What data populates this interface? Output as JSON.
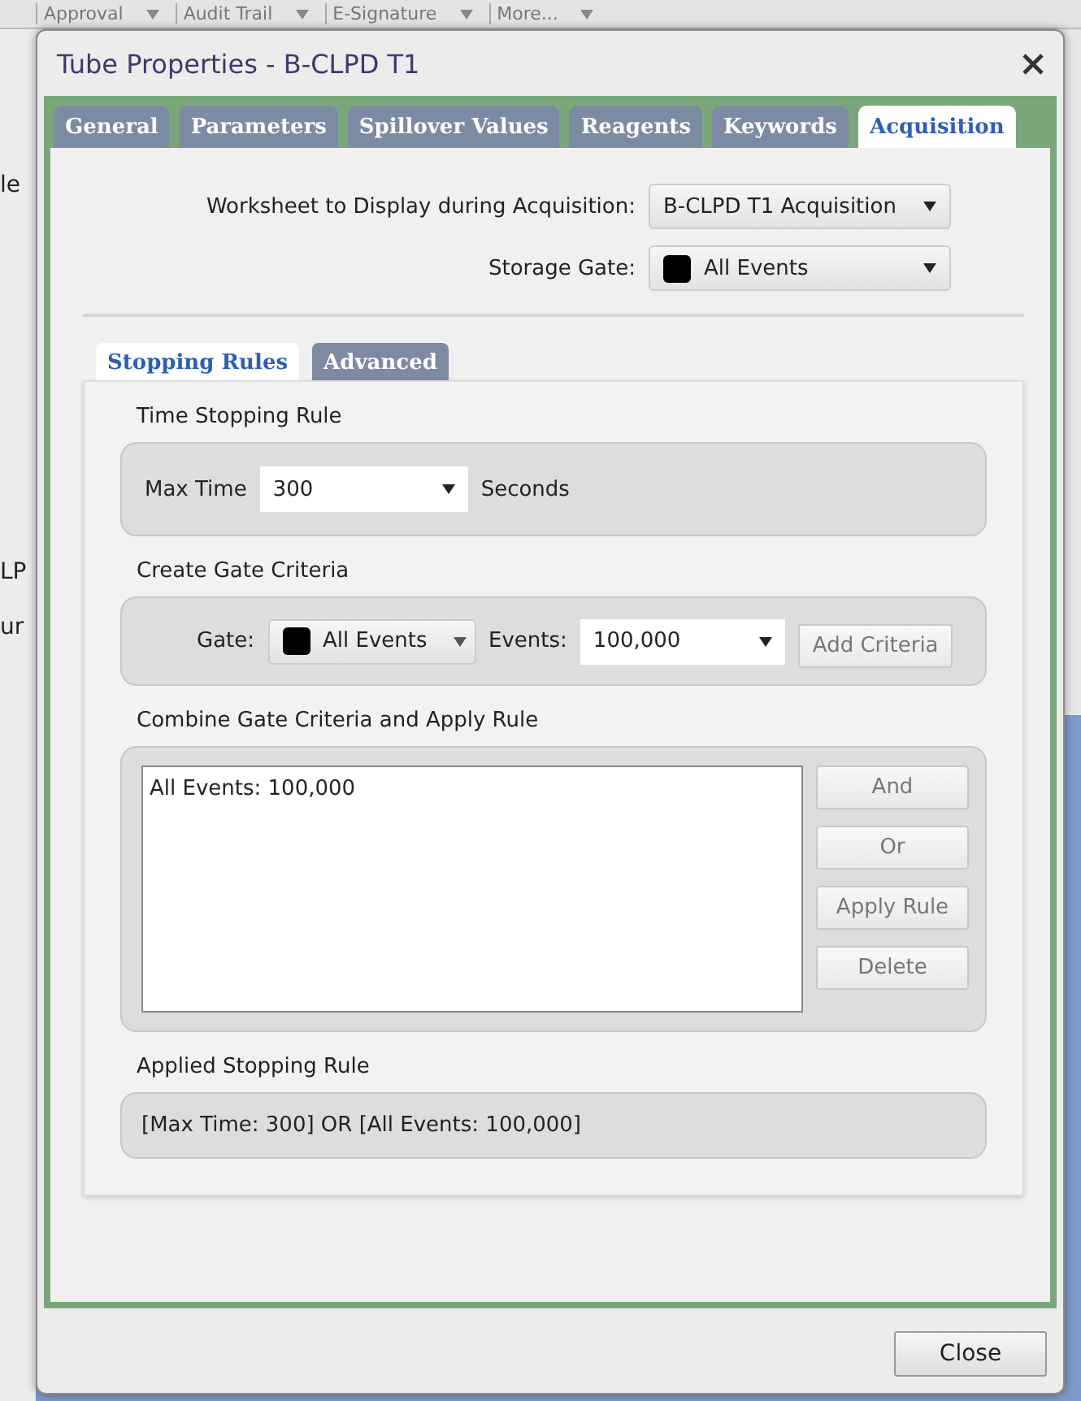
{
  "background": {
    "toolbar": [
      {
        "label": "Approval"
      },
      {
        "label": "Audit Trail"
      },
      {
        "label": "E-Signature"
      },
      {
        "label": "More..."
      }
    ],
    "side_fragments": [
      "le",
      "LP",
      "ur"
    ]
  },
  "dialog": {
    "title": "Tube Properties - B-CLPD T1",
    "tabs": [
      {
        "label": "General",
        "selected": false
      },
      {
        "label": "Parameters",
        "selected": false
      },
      {
        "label": "Spillover Values",
        "selected": false
      },
      {
        "label": "Reagents",
        "selected": false
      },
      {
        "label": "Keywords",
        "selected": false
      },
      {
        "label": "Acquisition",
        "selected": true
      }
    ],
    "worksheet": {
      "label": "Worksheet to Display during Acquisition:",
      "value": "B-CLPD T1 Acquisition"
    },
    "storage_gate": {
      "label": "Storage Gate:",
      "value": "All Events"
    },
    "subtabs": [
      {
        "label": "Stopping Rules",
        "selected": true
      },
      {
        "label": "Advanced",
        "selected": false
      }
    ],
    "time_rule": {
      "title": "Time Stopping Rule",
      "label": "Max Time",
      "value": "300",
      "unit": "Seconds"
    },
    "gate_criteria": {
      "title": "Create Gate Criteria",
      "gate_label": "Gate:",
      "gate_value": "All Events",
      "events_label": "Events:",
      "events_value": "100,000",
      "button": "Add Criteria"
    },
    "combine": {
      "title": "Combine Gate Criteria and Apply Rule",
      "items": [
        "All Events: 100,000"
      ],
      "buttons": [
        "And",
        "Or",
        "Apply Rule",
        "Delete"
      ]
    },
    "applied": {
      "title": "Applied Stopping Rule",
      "value": "[Max Time: 300] OR [All Events: 100,000]"
    },
    "footer_buttons": [
      "Close"
    ]
  }
}
